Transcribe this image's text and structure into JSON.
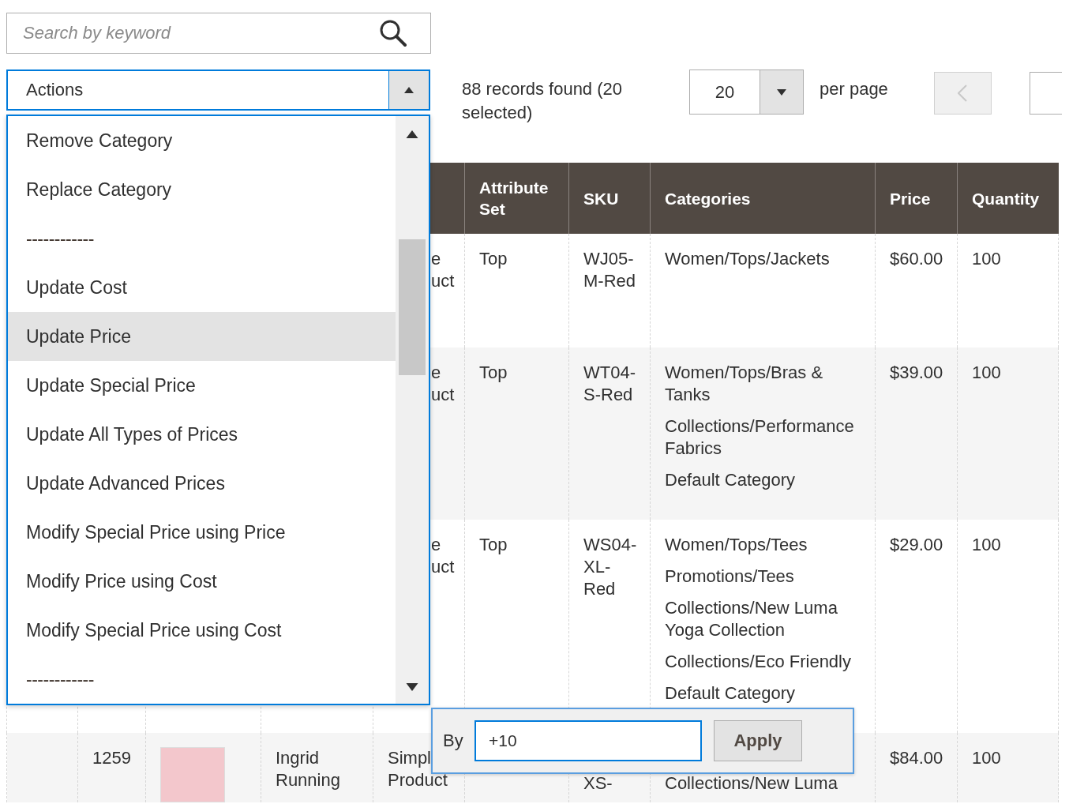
{
  "search": {
    "placeholder": "Search by keyword"
  },
  "actions": {
    "label": "Actions",
    "expanded": true,
    "options": [
      {
        "label": "Remove Category",
        "kind": "option",
        "selected": false
      },
      {
        "label": "Replace Category",
        "kind": "option",
        "selected": false
      },
      {
        "label": "------------",
        "kind": "separator",
        "selected": false
      },
      {
        "label": "Update Cost",
        "kind": "option",
        "selected": false
      },
      {
        "label": "Update Price",
        "kind": "option",
        "selected": true
      },
      {
        "label": "Update Special Price",
        "kind": "option",
        "selected": false
      },
      {
        "label": "Update All Types of Prices",
        "kind": "option",
        "selected": false
      },
      {
        "label": "Update Advanced Prices",
        "kind": "option",
        "selected": false
      },
      {
        "label": "Modify Special Price using Price",
        "kind": "option",
        "selected": false
      },
      {
        "label": "Modify Price using Cost",
        "kind": "option",
        "selected": false
      },
      {
        "label": "Modify Special Price using Cost",
        "kind": "option",
        "selected": false
      },
      {
        "label": "------------",
        "kind": "separator",
        "selected": false
      }
    ]
  },
  "records": "88 records found (20 selected)",
  "per_page": {
    "value": "20",
    "label": "per page"
  },
  "pager": {
    "prev": {
      "disabled": true
    }
  },
  "table": {
    "columns": [
      "Attribute Set",
      "SKU",
      "Categories",
      "Price",
      "Quantity"
    ],
    "rows": [
      {
        "type": [
          "e",
          "uct"
        ],
        "attribute_set": "Top",
        "sku": "WJ05-M-Red",
        "categories": [
          "Women/Tops/Jackets"
        ],
        "price": "$60.00",
        "quantity": "100"
      },
      {
        "type": [
          "e",
          "uct"
        ],
        "attribute_set": "Top",
        "sku": "WT04-S-Red",
        "categories": [
          "Women/Tops/Bras & Tanks",
          "Collections/Performance Fabrics",
          "Default Category"
        ],
        "price": "$39.00",
        "quantity": "100"
      },
      {
        "type": [
          "e",
          "uct"
        ],
        "attribute_set": "Top",
        "sku": "WS04-XL-Red",
        "categories": [
          "Women/Tops/Tees",
          "Promotions/Tees",
          "Collections/New Luma Yoga Collection",
          "Collections/Eco Friendly",
          "Default Category"
        ],
        "price": "$29.00",
        "quantity": "100"
      },
      {
        "id": "1259",
        "photo": true,
        "name": [
          "Ingrid",
          "Running"
        ],
        "type": [
          "Simpl",
          "Product"
        ],
        "sku": "XS-",
        "categories": [
          "Collections/New Luma"
        ],
        "price": "$84.00",
        "quantity": "100"
      }
    ]
  },
  "price_popup": {
    "label": "By",
    "value": "+10",
    "button": "Apply"
  }
}
